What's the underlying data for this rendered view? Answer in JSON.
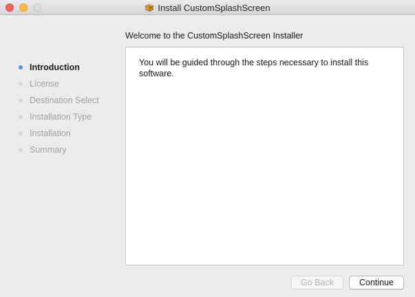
{
  "window": {
    "title": "Install CustomSplashScreen"
  },
  "main": {
    "heading": "Welcome to the CustomSplashScreen Installer",
    "body_text": "You will be guided through the steps necessary to install this software."
  },
  "sidebar": {
    "steps": [
      {
        "label": "Introduction",
        "active": true
      },
      {
        "label": "License",
        "active": false
      },
      {
        "label": "Destination Select",
        "active": false
      },
      {
        "label": "Installation Type",
        "active": false
      },
      {
        "label": "Installation",
        "active": false
      },
      {
        "label": "Summary",
        "active": false
      }
    ]
  },
  "buttons": {
    "back_label": "Go Back",
    "back_enabled": false,
    "continue_label": "Continue"
  },
  "colors": {
    "active_step_dot": "#4a90e2",
    "inactive_step_dot": "#d7d7d7",
    "close": "#fc605c",
    "minimize": "#fdbc40"
  },
  "icons": {
    "title_icon": "package-icon"
  }
}
